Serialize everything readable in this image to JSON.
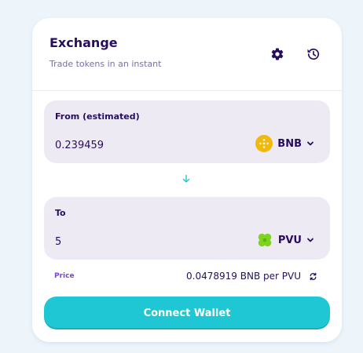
{
  "header": {
    "title": "Exchange",
    "subtitle": "Trade tokens in an instant",
    "settings_icon": "gear-icon",
    "history_icon": "history-icon"
  },
  "from": {
    "label": "From (estimated)",
    "value": "0.239459",
    "token": "BNB",
    "token_icon": "bnb-icon",
    "token_color": "#f0b90b"
  },
  "swap_arrow_icon": "arrow-down-icon",
  "to": {
    "label": "To",
    "value": "5",
    "token": "PVU",
    "token_icon": "pvu-clover-icon",
    "token_color": "#7ed321"
  },
  "price": {
    "label": "Price",
    "value": "0.0478919 BNB per PVU"
  },
  "connect_wallet_label": "Connect Wallet",
  "colors": {
    "accent": "#1fc7d4",
    "text_primary": "#280d5f",
    "text_secondary": "#7a6eaa",
    "price_label": "#7645d9",
    "panel_bg": "#eeeaf4"
  }
}
